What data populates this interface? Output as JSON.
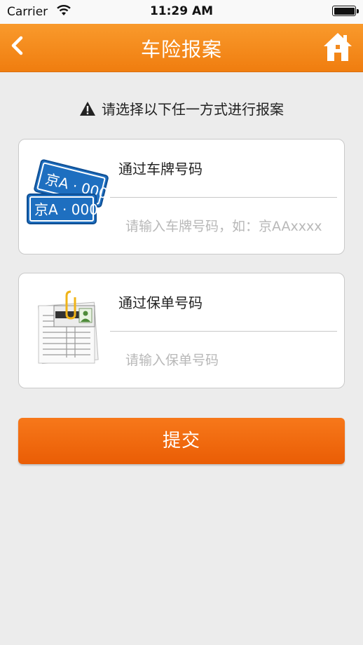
{
  "status_bar": {
    "carrier": "Carrier",
    "time": "11:29 AM",
    "wifi_icon": "wifi-icon",
    "battery_icon": "battery-icon"
  },
  "nav": {
    "title": "车险报案",
    "back_icon": "chevron-left-icon",
    "home_icon": "home-icon"
  },
  "instruction": {
    "icon": "warning-icon",
    "text": "请选择以下任一方式进行报案"
  },
  "options": [
    {
      "title": "通过车牌号码",
      "placeholder": "请输入车牌号码，如：京AAxxxx",
      "value": "",
      "illustration": "license-plate-icon",
      "plate_text": "京A · 000"
    },
    {
      "title": "通过保单号码",
      "placeholder": "请输入保单号码",
      "value": "",
      "illustration": "policy-document-icon"
    }
  ],
  "submit_label": "提交",
  "colors": {
    "accent": "#f28a1f",
    "submit": "#ee6510",
    "background": "#ececec",
    "plate_blue": "#1e6fc0"
  }
}
